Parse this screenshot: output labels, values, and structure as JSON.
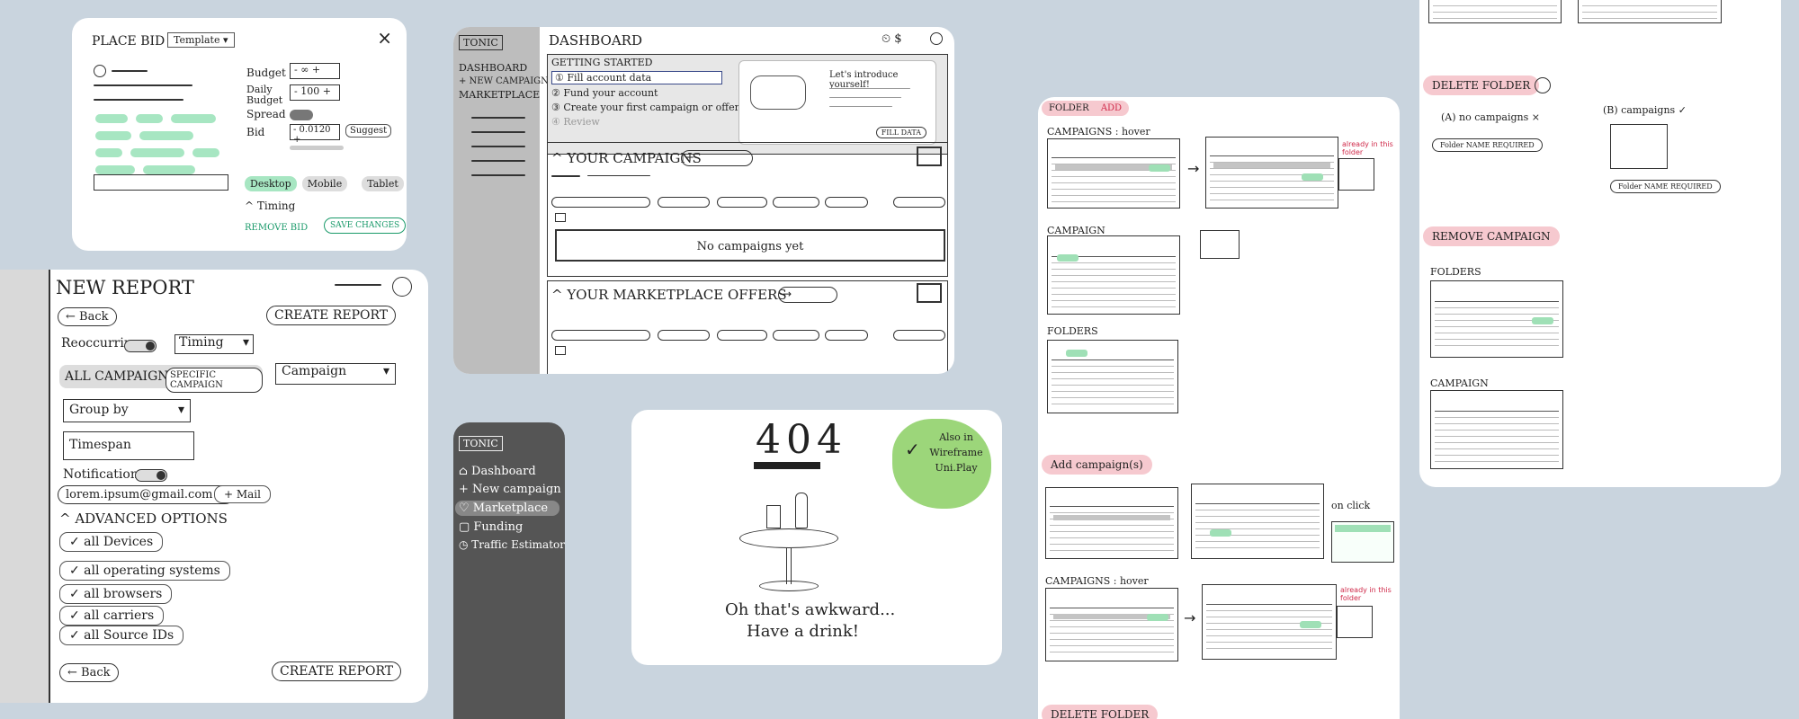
{
  "place_bid": {
    "title": "PLACE BID",
    "template_select": "Template",
    "close": "×",
    "budget_label": "Budget",
    "budget_value": "- ∞ +",
    "daily_budget_label": "Daily Budget",
    "daily_budget_value": "- 100 +",
    "spread_label": "Spread",
    "bid_label": "Bid",
    "bid_value": "- 0.0120 +",
    "suggest_label": "Suggest",
    "device_tabs": [
      "Desktop",
      "Mobile",
      "Tablet"
    ],
    "timing_label": "^ Timing",
    "remove_bid": "REMOVE BID",
    "save_changes": "SAVE CHANGES"
  },
  "dashboard": {
    "brand": "TONIC",
    "title": "DASHBOARD",
    "header_icons": "⏲ $",
    "nav": [
      "DASHBOARD",
      "+ NEW CAMPAIGN",
      "MARKETPLACE"
    ],
    "getting_started": "GETTING STARTED",
    "steps": [
      "① Fill account data",
      "② Fund your account",
      "③ Create your first campaign or offer",
      "④ Review"
    ],
    "intro_text": "Let's introduce yourself!",
    "fill_data": "FILL DATA",
    "your_campaigns": "^ YOUR CAMPAIGNS",
    "empty_campaigns": "No campaigns yet",
    "marketplace_offers": "^ YOUR MARKETPLACE OFFERS"
  },
  "new_report": {
    "title": "NEW REPORT",
    "back": "← Back",
    "create_report": "CREATE REPORT",
    "reoccurring": "Reoccurring",
    "timing": "Timing",
    "all_campaigns": "ALL CAMPAIGNS",
    "specific_campaign": "SPECIFIC CAMPAIGN",
    "campaign_select": "Campaign",
    "group_by": "Group by",
    "timespan": "Timespan",
    "notification": "Notification",
    "email": "lorem.ipsum@gmail.com  ×",
    "add_mail": "+ Mail",
    "advanced_options": "^ ADVANCED OPTIONS",
    "options": [
      "✓ all Devices",
      "✓ all operating systems",
      "✓ all browsers",
      "✓ all carriers",
      "✓ all Source IDs"
    ],
    "back_bottom": "← Back",
    "create_report_bottom": "CREATE REPORT"
  },
  "sidebar": {
    "brand": "TONIC",
    "items": [
      "⌂ Dashboard",
      "+ New campaign",
      "♡ Marketplace",
      "▢ Funding",
      "◷ Traffic Estimator"
    ]
  },
  "error_404": {
    "code": "404",
    "message_line1": "Oh that's awkward...",
    "message_line2": "Have a drink!",
    "sticky_note": "Also in Wireframe Uni.Play"
  },
  "flows_center": {
    "folder_tag": "FOLDER",
    "add_tag": "ADD",
    "campaigns_hover": "CAMPAIGNS : hover",
    "note_already": "already in this folder",
    "campaign_label": "CAMPAIGN",
    "folders_label": "FOLDERS",
    "add_campaigns": "Add campaign(s)",
    "on_click": "on click",
    "campaigns_hover_2": "CAMPAIGNS : hover",
    "delete_folder": "DELETE FOLDER"
  },
  "flows_right": {
    "delete_folder": "DELETE FOLDER",
    "no_campaigns": "(A) no campaigns ×",
    "campaigns": "(B) campaigns ✓",
    "folder_name_required": "Folder NAME REQUIRED",
    "remove_campaign": "REMOVE CAMPAIGN",
    "folders_label": "FOLDERS",
    "campaign_label": "CAMPAIGN"
  },
  "colors": {
    "background": "#c9d4de",
    "accent_green": "#9fe0b6",
    "tag_pink": "#f6c9cf",
    "sidebar_dark": "#555555",
    "sticky_green": "#9cd67a",
    "red_note": "#d02a4a"
  }
}
